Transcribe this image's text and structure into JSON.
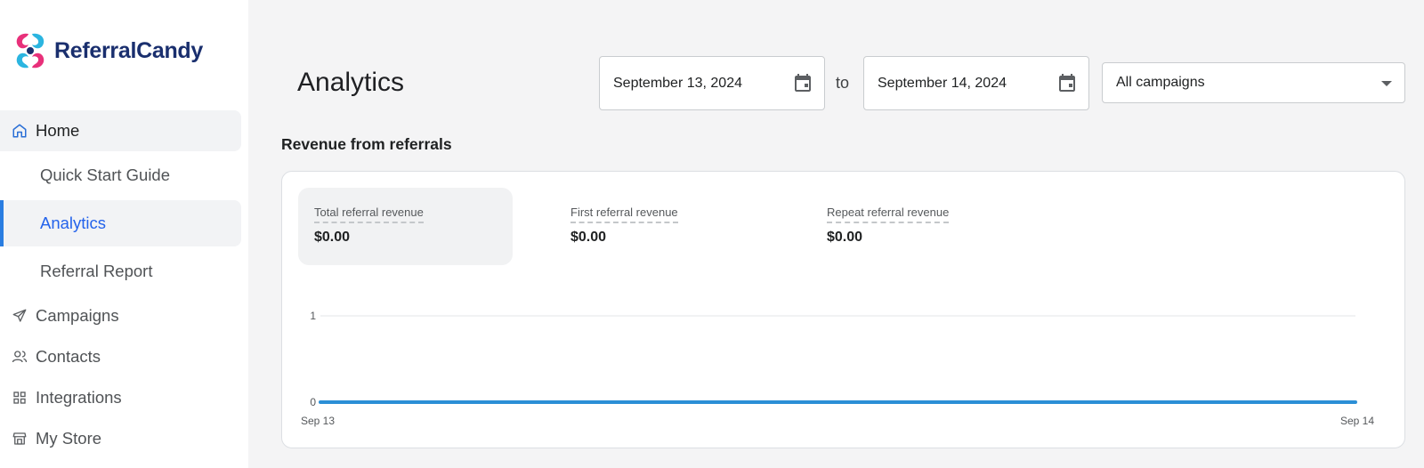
{
  "brand": {
    "name": "ReferralCandy"
  },
  "sidebar": {
    "home": {
      "label": "Home",
      "icon": "home-icon"
    },
    "sub_items": [
      {
        "label": "Quick Start Guide"
      },
      {
        "label": "Analytics",
        "active": true
      },
      {
        "label": "Referral Report"
      }
    ],
    "items": [
      {
        "label": "Campaigns",
        "icon": "send-icon"
      },
      {
        "label": "Contacts",
        "icon": "users-icon"
      },
      {
        "label": "Integrations",
        "icon": "grid-icon"
      },
      {
        "label": "My Store",
        "icon": "store-icon"
      }
    ]
  },
  "header": {
    "title": "Analytics",
    "start_date": "September 13, 2024",
    "to_label": "to",
    "end_date": "September 14, 2024",
    "campaign_select": "All campaigns"
  },
  "section": {
    "title": "Revenue from referrals"
  },
  "metrics": [
    {
      "label": "Total referral revenue",
      "value": "$0.00",
      "active": true
    },
    {
      "label": "First referral revenue",
      "value": "$0.00"
    },
    {
      "label": "Repeat referral revenue",
      "value": "$0.00"
    }
  ],
  "colors": {
    "accent": "#2a7de1",
    "line": "#2b8fd6"
  },
  "chart_data": {
    "type": "line",
    "x": [
      "Sep 13",
      "Sep 14"
    ],
    "series": [
      {
        "values": [
          0,
          0
        ]
      }
    ],
    "y_ticks": [
      "0",
      "1"
    ],
    "ylim": [
      0,
      1
    ],
    "grid": true
  }
}
